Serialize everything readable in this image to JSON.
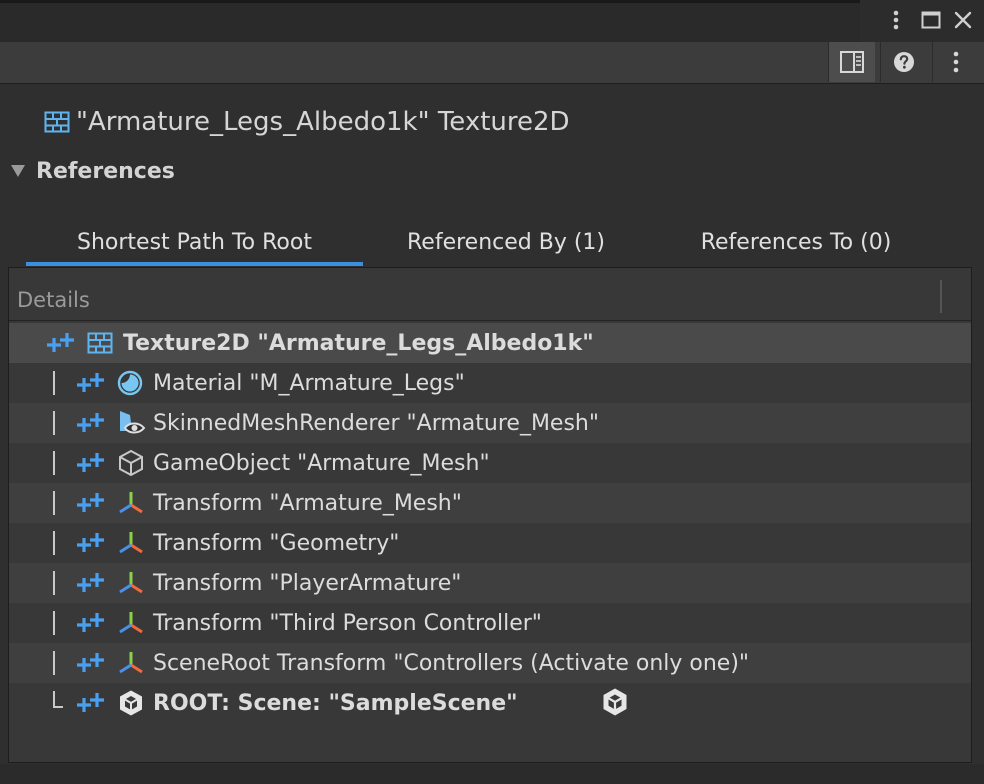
{
  "asset": {
    "title": "\"Armature_Legs_Albedo1k\" Texture2D",
    "icon": "texture-icon"
  },
  "foldout": {
    "label": "References",
    "expanded": true
  },
  "tabs": [
    {
      "label": "Shortest Path To Root",
      "selected": true
    },
    {
      "label": "Referenced By (1)",
      "selected": false
    },
    {
      "label": "References To (0)",
      "selected": false
    }
  ],
  "details": {
    "header": "Details",
    "rows": [
      {
        "text": "Texture2D \"Armature_Legs_Albedo1k\"",
        "icon": "texture-icon",
        "bold": true,
        "selected": true
      },
      {
        "text": "Material \"M_Armature_Legs\"",
        "icon": "material-icon"
      },
      {
        "text": "SkinnedMeshRenderer \"Armature_Mesh\"",
        "icon": "skinned-mesh-renderer-icon"
      },
      {
        "text": "GameObject \"Armature_Mesh\"",
        "icon": "gameobject-icon"
      },
      {
        "text": "Transform \"Armature_Mesh\"",
        "icon": "transform-icon"
      },
      {
        "text": "Transform \"Geometry\"",
        "icon": "transform-icon"
      },
      {
        "text": "Transform \"PlayerArmature\"",
        "icon": "transform-icon"
      },
      {
        "text": "Transform \"Third Person Controller\"",
        "icon": "transform-icon"
      },
      {
        "text": "SceneRoot Transform \"Controllers (Activate only one)\"",
        "icon": "transform-icon"
      },
      {
        "text": "ROOT: Scene: \"SampleScene\"",
        "icon": "unity-scene-icon",
        "bold": true
      }
    ]
  },
  "colors": {
    "accent": "#3a8fe0",
    "plus": "#4aa0f0",
    "texture": "#5fb4f0"
  }
}
